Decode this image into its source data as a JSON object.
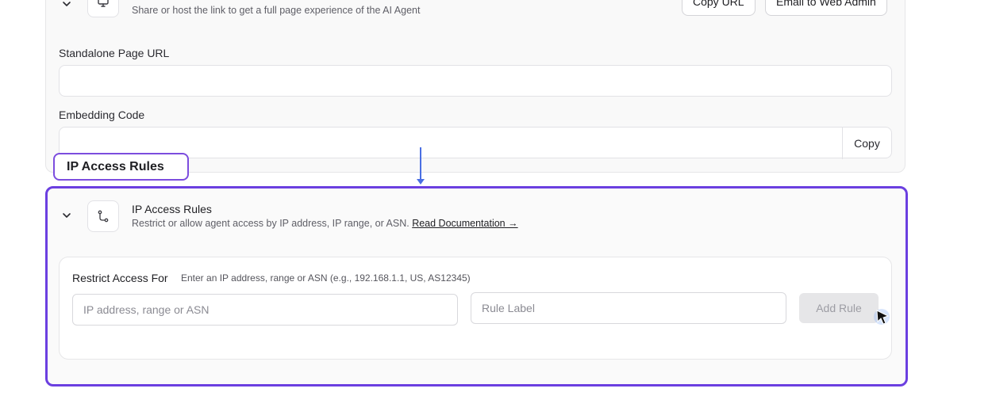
{
  "top_section": {
    "description": "Share or host the link to get a full page experience of the AI Agent",
    "copy_url_label": "Copy URL",
    "email_label": "Email to Web Admin",
    "standalone_label": "Standalone Page URL",
    "standalone_value": "",
    "embedding_label": "Embedding Code",
    "embedding_value": "",
    "copy_label": "Copy"
  },
  "callout": {
    "label": "IP Access Rules"
  },
  "ip_section": {
    "title": "IP Access Rules",
    "description": "Restrict or allow agent access by IP address, IP range, or ASN.",
    "doc_link": "Read Documentation →",
    "restrict_label": "Restrict Access For",
    "restrict_hint": "Enter an IP address, range or ASN (e.g., 192.168.1.1, US, AS12345)",
    "ip_placeholder": "IP address, range or ASN",
    "rule_label_placeholder": "Rule Label",
    "add_rule_label": "Add Rule"
  },
  "colors": {
    "highlight_border": "#6b3fe0",
    "arrow": "#4a6fe3",
    "disabled_button": "#e6e6e8"
  },
  "icons": {
    "top_chevron": "chevron-down-icon",
    "top_icon": "monitor-icon",
    "ip_chevron": "chevron-down-icon",
    "ip_icon": "route-icon",
    "cursor": "mouse-pointer-icon"
  }
}
